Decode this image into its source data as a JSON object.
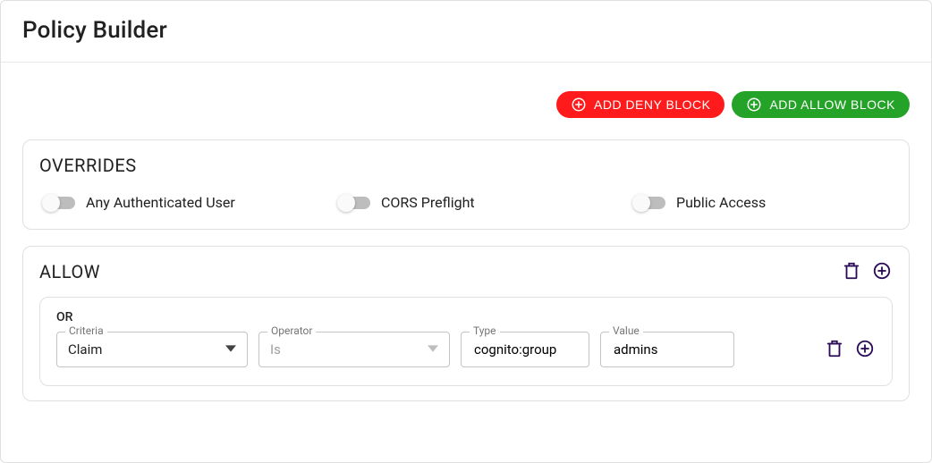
{
  "title": "Policy Builder",
  "actions": {
    "add_deny": "ADD DENY BLOCK",
    "add_allow": "ADD ALLOW BLOCK"
  },
  "overrides": {
    "heading": "Overrides",
    "items": [
      {
        "label": "Any Authenticated User",
        "checked": false
      },
      {
        "label": "CORS Preflight",
        "checked": false
      },
      {
        "label": "Public Access",
        "checked": false
      }
    ]
  },
  "allow_block": {
    "heading": "Allow",
    "groups": [
      {
        "logic": "OR",
        "conditions": [
          {
            "criteria_label": "Criteria",
            "criteria_value": "Claim",
            "operator_label": "Operator",
            "operator_value": "Is",
            "type_label": "Type",
            "type_value": "cognito:group",
            "value_label": "Value",
            "value_value": "admins"
          }
        ]
      }
    ]
  }
}
